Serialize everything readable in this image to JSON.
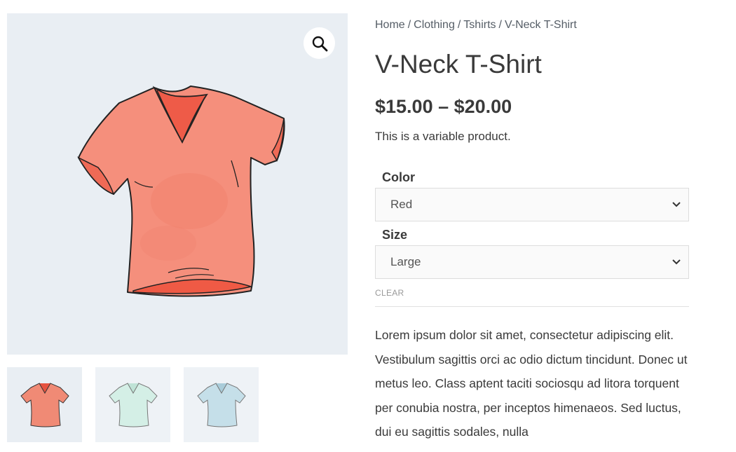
{
  "breadcrumb": {
    "home": "Home",
    "clothing": "Clothing",
    "tshirts": "Tshirts",
    "current": "V-Neck T-Shirt",
    "separator": "/"
  },
  "product": {
    "title": "V-Neck T-Shirt",
    "price": "$15.00 – $20.00",
    "short_description": "This is a variable product.",
    "long_description": "Lorem ipsum dolor sit amet, consectetur adipiscing elit. Vestibulum sagittis orci ac odio dictum tincidunt. Donec ut metus leo. Class aptent taciti sociosqu ad litora torquent per conubia nostra, per inceptos himenaeos. Sed luctus, dui eu sagittis sodales, nulla"
  },
  "variations": {
    "color_label": "Color",
    "color_value": "Red",
    "size_label": "Size",
    "size_value": "Large",
    "clear_label": "CLEAR"
  },
  "gallery": {
    "zoom_icon": "magnifier-icon",
    "thumbnails": [
      {
        "name": "red v-neck",
        "color": "#f08a75"
      },
      {
        "name": "mint v-neck",
        "color": "#d4efe6"
      },
      {
        "name": "blue v-neck",
        "color": "#c5dfe9"
      }
    ]
  },
  "colors": {
    "image_bg": "#e9eef3",
    "text": "#3a3a3a",
    "shirt_red": "#f4897a"
  }
}
